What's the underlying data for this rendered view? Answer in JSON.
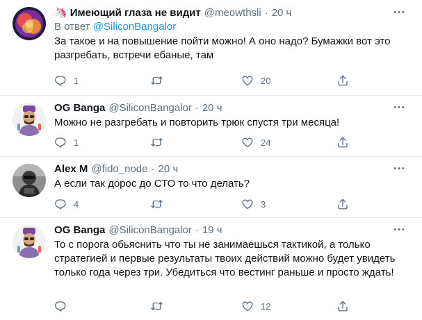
{
  "tweets": [
    {
      "name": "Имеющий глаза не видит",
      "name_emoji": "🦄",
      "handle": "@meowthsli",
      "dot": "·",
      "time": "20 ч",
      "reply_prefix": "В ответ",
      "reply_to": "@SiliconBangalor",
      "text": "За такое и на повышение пойти можно! А оно надо? Бумажки вот это разгребать, встречи ебаные, там",
      "replies": "1",
      "retweets": "",
      "likes": "20"
    },
    {
      "name": "OG Banga",
      "handle": "@SiliconBangalor",
      "dot": "·",
      "time": "20 ч",
      "text": "Можно не разгребать и повторить трюк спустя три месяца!",
      "replies": "1",
      "retweets": "",
      "likes": "24"
    },
    {
      "name": "Alex M",
      "handle": "@fido_node",
      "dot": "·",
      "time": "20 ч",
      "text": "А если так дорос до СТО то что делать?",
      "replies": "4",
      "retweets": "",
      "likes": "3"
    },
    {
      "name": "OG Banga",
      "handle": "@SiliconBangalor",
      "dot": "·",
      "time": "19 ч",
      "text": "То с порога обьяснить что ты не занимаешься тактикой, а только стратегией и первые результаты твоих действий можно будет увидеть только года через три. Убедиться что вестинг раньше и просто ждать!",
      "replies": "",
      "retweets": "",
      "likes": "12"
    }
  ],
  "icons": {
    "reply": "reply-icon",
    "retweet": "retweet-icon",
    "like": "heart-icon",
    "share": "share-icon",
    "more": "more-icon"
  },
  "colors": {
    "text": "#0f1419",
    "secondary": "#5b7083",
    "link": "#1b95e0",
    "divider": "#e6ecf0"
  }
}
